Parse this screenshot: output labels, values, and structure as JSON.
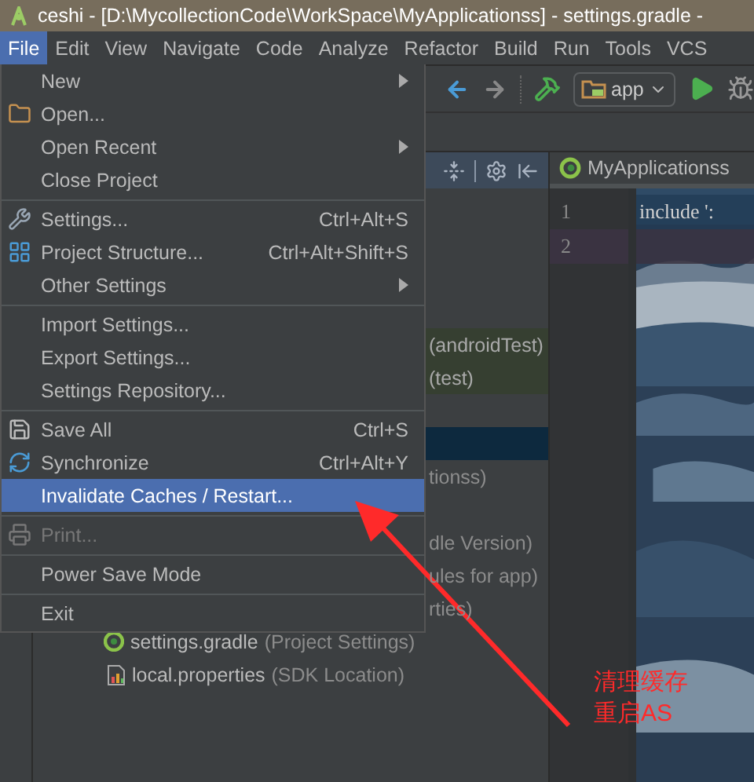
{
  "window": {
    "title": "ceshi - [D:\\MycollectionCode\\WorkSpace\\MyApplicationss] - settings.gradle -"
  },
  "menubar": [
    {
      "label": "File",
      "selected": true
    },
    {
      "label": "Edit",
      "selected": false
    },
    {
      "label": "View",
      "selected": false
    },
    {
      "label": "Navigate",
      "selected": false
    },
    {
      "label": "Code",
      "selected": false
    },
    {
      "label": "Analyze",
      "selected": false
    },
    {
      "label": "Refactor",
      "selected": false
    },
    {
      "label": "Build",
      "selected": false
    },
    {
      "label": "Run",
      "selected": false
    },
    {
      "label": "Tools",
      "selected": false
    },
    {
      "label": "VCS",
      "selected": false
    }
  ],
  "toolbar": {
    "run_config": "app"
  },
  "project_panel": {
    "tree_groups": [
      [
        {
          "kind": "test",
          "text": "(androidTest)",
          "selected": false
        },
        {
          "kind": "test",
          "text": "(test)",
          "selected": false
        }
      ],
      [
        {
          "kind": "plain",
          "selected": true
        },
        {
          "kind": "plain",
          "text": "tionss)",
          "selected": false
        }
      ],
      [
        {
          "kind": "plain",
          "text": "dle Version)",
          "selected": false
        },
        {
          "kind": "plain",
          "text": "ules for app)",
          "selected": false
        },
        {
          "kind": "plain",
          "text": "rties)",
          "selected": false
        },
        {
          "kind": "gradle-file",
          "text": "settings.gradle",
          "detail": "(Project Settings)",
          "selected": false
        },
        {
          "kind": "properties-file",
          "text": "local.properties",
          "detail": "(SDK Location)",
          "selected": false
        }
      ]
    ]
  },
  "editor": {
    "tab": "MyApplicationss",
    "lines": [
      {
        "number": "1",
        "code": "include ':",
        "current": false
      },
      {
        "number": "2",
        "current": true
      }
    ]
  },
  "file_menu": {
    "sections": [
      {
        "items": [
          {
            "label": "New",
            "submenu": true,
            "selected": false,
            "disabled": false
          },
          {
            "label": "Open...",
            "submenu": false,
            "selected": false,
            "disabled": false
          },
          {
            "label": "Open Recent",
            "submenu": true,
            "selected": false,
            "disabled": false
          },
          {
            "label": "Close Project",
            "submenu": false,
            "selected": false,
            "disabled": false
          }
        ]
      },
      {
        "items": [
          {
            "label": "Settings...",
            "shortcut": "Ctrl+Alt+S",
            "submenu": false,
            "selected": false,
            "disabled": false
          },
          {
            "label": "Project Structure...",
            "shortcut": "Ctrl+Alt+Shift+S",
            "submenu": false,
            "selected": false,
            "disabled": false
          },
          {
            "label": "Other Settings",
            "submenu": true,
            "selected": false,
            "disabled": false
          }
        ]
      },
      {
        "items": [
          {
            "label": "Import Settings...",
            "submenu": false,
            "selected": false,
            "disabled": false
          },
          {
            "label": "Export Settings...",
            "submenu": false,
            "selected": false,
            "disabled": false
          },
          {
            "label": "Settings Repository...",
            "submenu": false,
            "selected": false,
            "disabled": false
          }
        ]
      },
      {
        "items": [
          {
            "label": "Save All",
            "shortcut": "Ctrl+S",
            "submenu": false,
            "selected": false,
            "disabled": false
          },
          {
            "label": "Synchronize",
            "shortcut": "Ctrl+Alt+Y",
            "submenu": false,
            "selected": false,
            "disabled": false
          },
          {
            "label": "Invalidate Caches / Restart...",
            "submenu": false,
            "selected": true,
            "disabled": false
          }
        ]
      },
      {
        "items": [
          {
            "label": "Print...",
            "submenu": false,
            "selected": false,
            "disabled": true
          }
        ]
      },
      {
        "items": [
          {
            "label": "Power Save Mode",
            "submenu": false,
            "selected": false,
            "disabled": false
          }
        ]
      },
      {
        "items": [
          {
            "label": "Exit",
            "submenu": false,
            "selected": false,
            "disabled": false
          }
        ]
      }
    ]
  },
  "annotation": {
    "lines": [
      "清理缓存",
      "重启AS"
    ]
  }
}
